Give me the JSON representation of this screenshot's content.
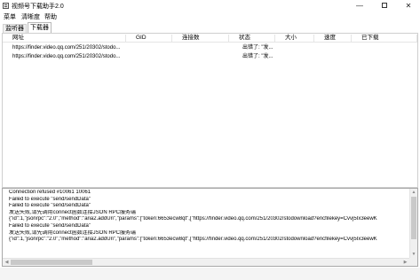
{
  "window": {
    "title": "视频号下载助手2.0",
    "icon": "app-icon",
    "minimize_glyph": "—",
    "close_glyph": "✕"
  },
  "menu": [
    "菜单",
    "清晰度",
    "帮助"
  ],
  "tabs": [
    {
      "label": "监听器",
      "active": false
    },
    {
      "label": "下载器",
      "active": true
    }
  ],
  "list": {
    "columns": [
      "网址",
      "GID",
      "连接数",
      "状态",
      "大小",
      "速度",
      "已下载"
    ],
    "rows": [
      {
        "url": "https://finder.video.qq.com/251/20302/stodo...",
        "gid": "",
        "connections": "",
        "status": "出错了: \"发...",
        "size": "",
        "speed": "",
        "downloaded": ""
      },
      {
        "url": "https://finder.video.qq.com/251/20302/stodo...",
        "gid": "",
        "connections": "",
        "status": "出错了: \"发...",
        "size": "",
        "speed": "",
        "downloaded": ""
      }
    ]
  },
  "log": [
    "Connection refused #10061        10061",
    "Failed to execute \"send/sendData\"",
    "Failed to execute \"send/sendData\"",
    "发送失败,请先调用connect函数连接JSON RPC服务端",
    "{\"id\":1,\"jsonrpc\":\"2.0\",\"method\":\"aria2.addUri\",\"params\":[\"token:6653ecw8qt\",[\"https://finder.video.qq.com/251/20302/stodownload?encfilekey=Cvvj5Ix3eewK",
    "Failed to execute \"send/sendData\"",
    "发送失败,请先调用connect函数连接JSON RPC服务端",
    "{\"id\":1,\"jsonrpc\":\"2.0\",\"method\":\"aria2.addUri\",\"params\":[\"token:6653ecw8qt\",[\"https://finder.video.qq.com/251/20302/stodownload?encfilekey=Cvvj5Ix3eewK"
  ]
}
